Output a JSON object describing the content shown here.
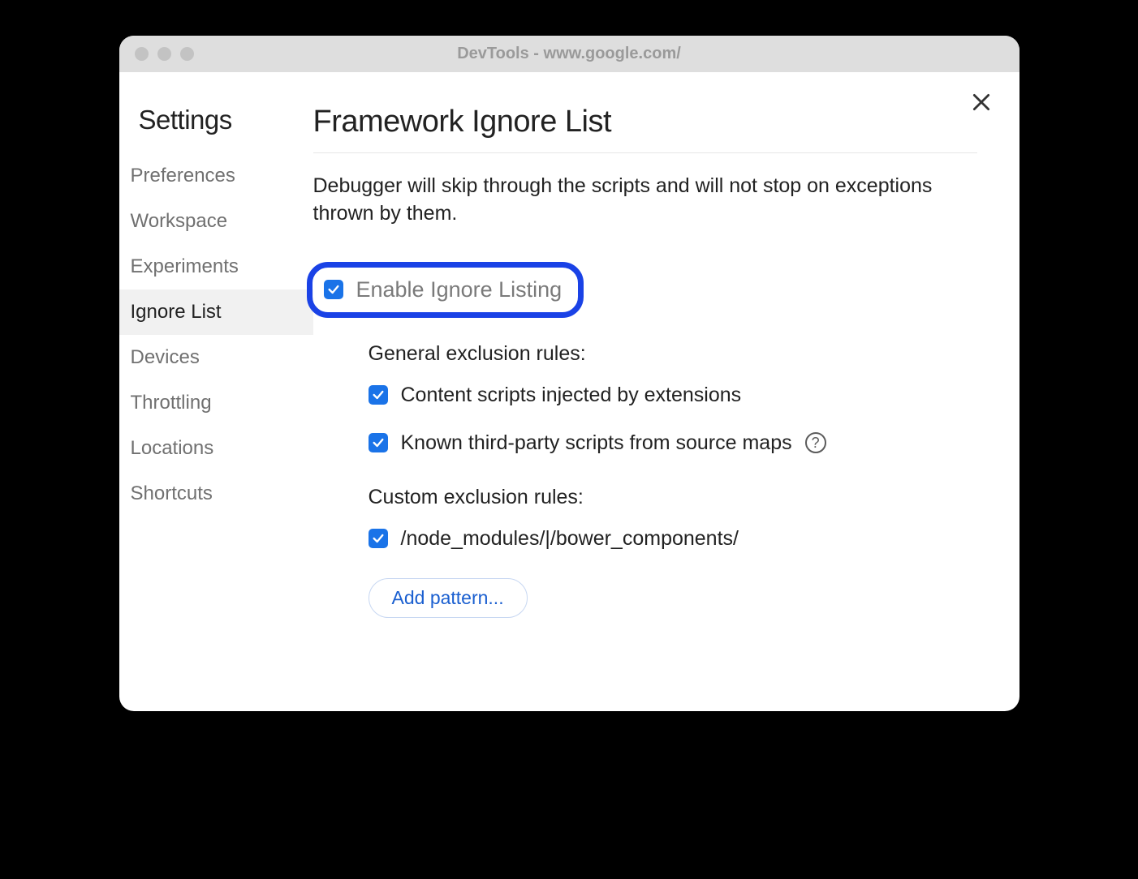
{
  "window": {
    "title": "DevTools - www.google.com/"
  },
  "sidebar": {
    "title": "Settings",
    "items": [
      {
        "label": "Preferences",
        "active": false
      },
      {
        "label": "Workspace",
        "active": false
      },
      {
        "label": "Experiments",
        "active": false
      },
      {
        "label": "Ignore List",
        "active": true
      },
      {
        "label": "Devices",
        "active": false
      },
      {
        "label": "Throttling",
        "active": false
      },
      {
        "label": "Locations",
        "active": false
      },
      {
        "label": "Shortcuts",
        "active": false
      }
    ]
  },
  "main": {
    "title": "Framework Ignore List",
    "description": "Debugger will skip through the scripts and will not stop on exceptions thrown by them.",
    "enable": {
      "label": "Enable Ignore Listing",
      "checked": true
    },
    "general": {
      "title": "General exclusion rules:",
      "rules": [
        {
          "label": "Content scripts injected by extensions",
          "checked": true,
          "help": false
        },
        {
          "label": "Known third-party scripts from source maps",
          "checked": true,
          "help": true
        }
      ]
    },
    "custom": {
      "title": "Custom exclusion rules:",
      "rules": [
        {
          "label": "/node_modules/|/bower_components/",
          "checked": true
        }
      ],
      "add_button": "Add pattern..."
    },
    "help_glyph": "?"
  }
}
